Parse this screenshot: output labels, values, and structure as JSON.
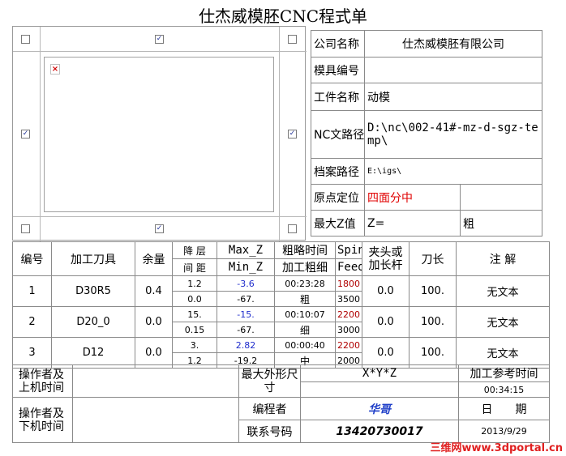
{
  "title": "仕杰威模胚CNC程式单",
  "preview_panel": {
    "checkboxes": {
      "top_left": false,
      "top_center": true,
      "top_right": false,
      "mid_left": true,
      "mid_right": true,
      "bottom_left": false,
      "bottom_center": true,
      "bottom_right": false
    },
    "image_icon": "broken-image-icon"
  },
  "info": {
    "company_label": "公司名称",
    "company_value": "仕杰威模胚有限公司",
    "mold_no_label": "模具编号",
    "mold_no_value": "",
    "part_label": "工件名称",
    "part_value": "动模",
    "nc_path_label": "NC文路径",
    "nc_path_value": "D:\\nc\\002-41#-mz-d-sgz-temp\\",
    "archive_label": "档案路径",
    "archive_value": "E:\\igs\\",
    "origin_label": "原点定位",
    "origin_value": "四面分中",
    "origin_extra": "",
    "maxz_label": "最大Z值",
    "maxz_value": "Z=",
    "maxz_extra": "粗"
  },
  "tools_header": {
    "no": "编号",
    "tool": "加工刀具",
    "allowance": "余量",
    "step_top": "降 层",
    "step_bottom": "间 距",
    "maxz": "Max_Z",
    "minz": "Min_Z",
    "time_top": "粗略时间",
    "time_bottom": "加工粗细",
    "spin": "Spin",
    "feed": "Feed",
    "holder": "夹头或加长杆",
    "length": "刀长",
    "note": "注 解"
  },
  "tools": [
    {
      "no": "1",
      "tool": "D30R5",
      "allowance": "0.4",
      "step": "1.2",
      "spacing": "0.0",
      "max_z": "-3.6",
      "min_z": "-67.",
      "time": "00:23:28",
      "finish": "粗",
      "spin": "1800",
      "feed": "3500",
      "holder": "0.0",
      "length": "100.",
      "note": "无文本"
    },
    {
      "no": "2",
      "tool": "D20_0",
      "allowance": "0.0",
      "step": "15.",
      "spacing": "0.15",
      "max_z": "-15.",
      "min_z": "-67.",
      "time": "00:10:07",
      "finish": "细",
      "spin": "2200",
      "feed": "3000",
      "holder": "0.0",
      "length": "100.",
      "note": "无文本"
    },
    {
      "no": "3",
      "tool": "D12",
      "allowance": "0.0",
      "step": "3.",
      "spacing": "1.2",
      "max_z": "2.82",
      "min_z": "-19.2",
      "time": "00:00:40",
      "finish": "中",
      "spin": "2200",
      "feed": "2000",
      "holder": "0.0",
      "length": "100.",
      "note": "无文本"
    }
  ],
  "footer": {
    "operator_on": "操作者及上机时间",
    "operator_on_value": "",
    "max_size_label": "最大外形尺寸",
    "max_size_value": "X*Y*Z",
    "max_size_extra": "",
    "ref_time_label": "加工参考时间",
    "ref_time_value": "00:34:15",
    "operator_off": "操作者及下机时间",
    "operator_off_value": "",
    "programmer_label": "编程者",
    "programmer_value": "华哥",
    "date_label": "日　　期",
    "phone_label": "联系号码",
    "phone_value": "13420730017",
    "date_value": "2013/9/29"
  },
  "watermark": "三维网www.3dportal.cn"
}
